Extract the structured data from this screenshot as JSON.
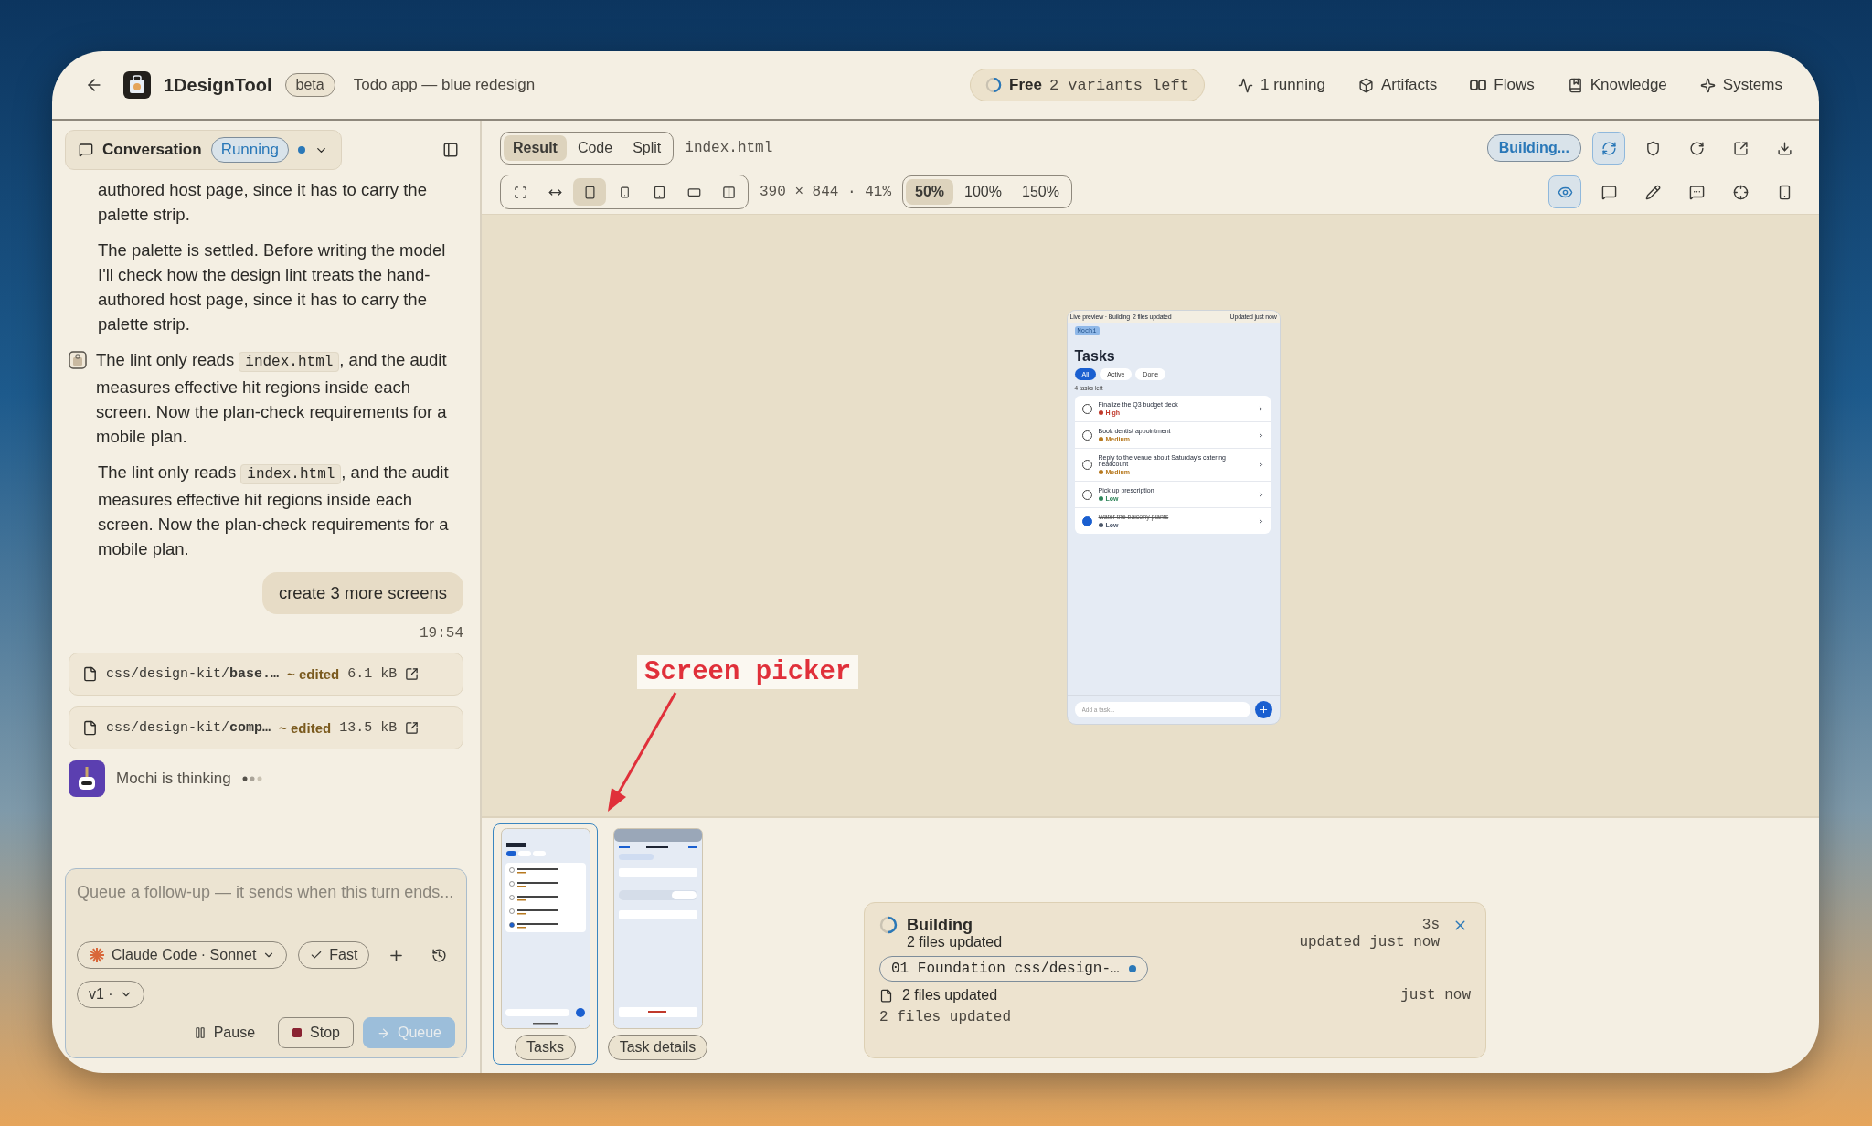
{
  "header": {
    "app_name": "1DesignTool",
    "badge": "beta",
    "project": "Todo app — blue redesign",
    "plan": {
      "label": "Free",
      "detail": "2 variants left"
    },
    "nav": [
      {
        "kind": "activity",
        "label": "1 running"
      },
      {
        "kind": "box",
        "label": "Artifacts"
      },
      {
        "kind": "flows",
        "label": "Flows"
      },
      {
        "kind": "book",
        "label": "Knowledge"
      },
      {
        "kind": "sparkle",
        "label": "Systems"
      }
    ]
  },
  "conversation": {
    "title": "Conversation",
    "status": "Running",
    "messages": [
      {
        "kind": "text",
        "parts": [
          {
            "text": "authored host page, since it has to carry the palette strip."
          }
        ]
      },
      {
        "kind": "text",
        "parts": [
          {
            "text": "The palette is settled. Before writing the model I'll check how the design lint treats the hand-authored host page, since it has to carry the palette strip."
          }
        ]
      },
      {
        "kind": "agent",
        "parts": [
          {
            "text": "The lint only reads "
          },
          {
            "code": "index.html"
          },
          {
            "text": ", and the audit measures effective hit regions inside each screen. Now the plan-check requirements for a mobile plan."
          }
        ]
      },
      {
        "kind": "text",
        "parts": [
          {
            "text": "The lint only reads "
          },
          {
            "code": "index.html"
          },
          {
            "text": ", and the audit measures effective hit regions inside each screen. Now the plan-check requirements for a mobile plan."
          }
        ]
      },
      {
        "kind": "user",
        "parts": [
          {
            "text": "create 3 more screens"
          }
        ]
      },
      {
        "kind": "time",
        "parts": [
          {
            "text": "19:54"
          }
        ]
      }
    ],
    "files": [
      {
        "path": "css/design-kit/**base.…**",
        "status": "~ edited",
        "size": "6.1 kB"
      },
      {
        "path": "css/design-kit/**comp…**",
        "status": "~ edited",
        "size": "13.5 kB"
      }
    ],
    "thinking": "Mochi is thinking",
    "composer": {
      "placeholder": "Queue a follow-up — it sends when this turn ends...",
      "model": "Claude Code · Sonnet",
      "fast": {
        "label": "Fast",
        "checked": true
      },
      "version": "v1 ·",
      "buttons": [
        {
          "kind": "pause",
          "label": "Pause",
          "disabled": false
        },
        {
          "kind": "stop",
          "label": "Stop",
          "disabled": false
        },
        {
          "kind": "queue",
          "label": "Queue",
          "disabled": true
        }
      ]
    }
  },
  "preview": {
    "view_tabs": [
      {
        "label": "Result",
        "selected": true
      },
      {
        "label": "Code",
        "selected": false
      },
      {
        "label": "Split",
        "selected": false
      }
    ],
    "file": "index.html",
    "devices": [
      {
        "kind": "fit",
        "selected": false
      },
      {
        "kind": "width",
        "selected": false
      },
      {
        "kind": "phone",
        "selected": true
      },
      {
        "kind": "small-phone",
        "selected": false
      },
      {
        "kind": "tablet",
        "selected": false
      },
      {
        "kind": "landscape",
        "selected": false
      },
      {
        "kind": "columns",
        "selected": false
      }
    ],
    "dimensions": "390 × 844 · 41%",
    "zooms": [
      {
        "label": "50%",
        "selected": true
      },
      {
        "label": "100%",
        "selected": false
      },
      {
        "label": "150%",
        "selected": false
      }
    ],
    "status": "Building...",
    "actions": [
      {
        "kind": "refresh",
        "active": true
      },
      {
        "kind": "shield",
        "active": false
      },
      {
        "kind": "reload",
        "active": false
      },
      {
        "kind": "external",
        "active": false
      },
      {
        "kind": "download",
        "active": false
      }
    ],
    "tools": [
      {
        "kind": "eye",
        "active": true
      },
      {
        "kind": "comment",
        "active": false
      },
      {
        "kind": "pencil",
        "active": false
      },
      {
        "kind": "question",
        "active": false
      },
      {
        "kind": "crosshair",
        "active": false
      },
      {
        "kind": "phone",
        "active": false
      }
    ],
    "phone": {
      "status": "Live preview · Building",
      "files": "2 files updated",
      "updated": "Updated just now",
      "tag": "Mochi",
      "title": "Tasks",
      "filters": [
        {
          "label": "All",
          "selected": true
        },
        {
          "label": "Active",
          "selected": false
        },
        {
          "label": "Done",
          "selected": false
        }
      ],
      "count": "4 tasks left",
      "tasks": [
        {
          "title": "Finalize the Q3 budget deck",
          "priority": "High",
          "color": "#c0392b",
          "done": false
        },
        {
          "title": "Book dentist appointment",
          "priority": "Medium",
          "color": "#b7791f",
          "done": false
        },
        {
          "title": "Reply to the venue about Saturday's catering headcount",
          "priority": "Medium",
          "color": "#b7791f",
          "done": false
        },
        {
          "title": "Pick up prescription",
          "priority": "Low",
          "color": "#2f855a",
          "done": false
        },
        {
          "title": "Water the balcony plants",
          "priority": "Low",
          "color": "#4a5568",
          "done": true
        }
      ],
      "input_placeholder": "Add a task..."
    }
  },
  "screens": [
    {
      "label": "Tasks",
      "kind": "list",
      "selected": true
    },
    {
      "label": "Task details",
      "kind": "details",
      "selected": false
    }
  ],
  "build": {
    "title": "Building",
    "subtitle": "2 files updated",
    "elapsed": "3s",
    "updated": "updated just now",
    "chip": "01 Foundation css/design-…",
    "row": {
      "text": "2 files updated",
      "time": "just now"
    },
    "footer": "2 files updated"
  },
  "annotation": {
    "label": "Screen picker"
  }
}
